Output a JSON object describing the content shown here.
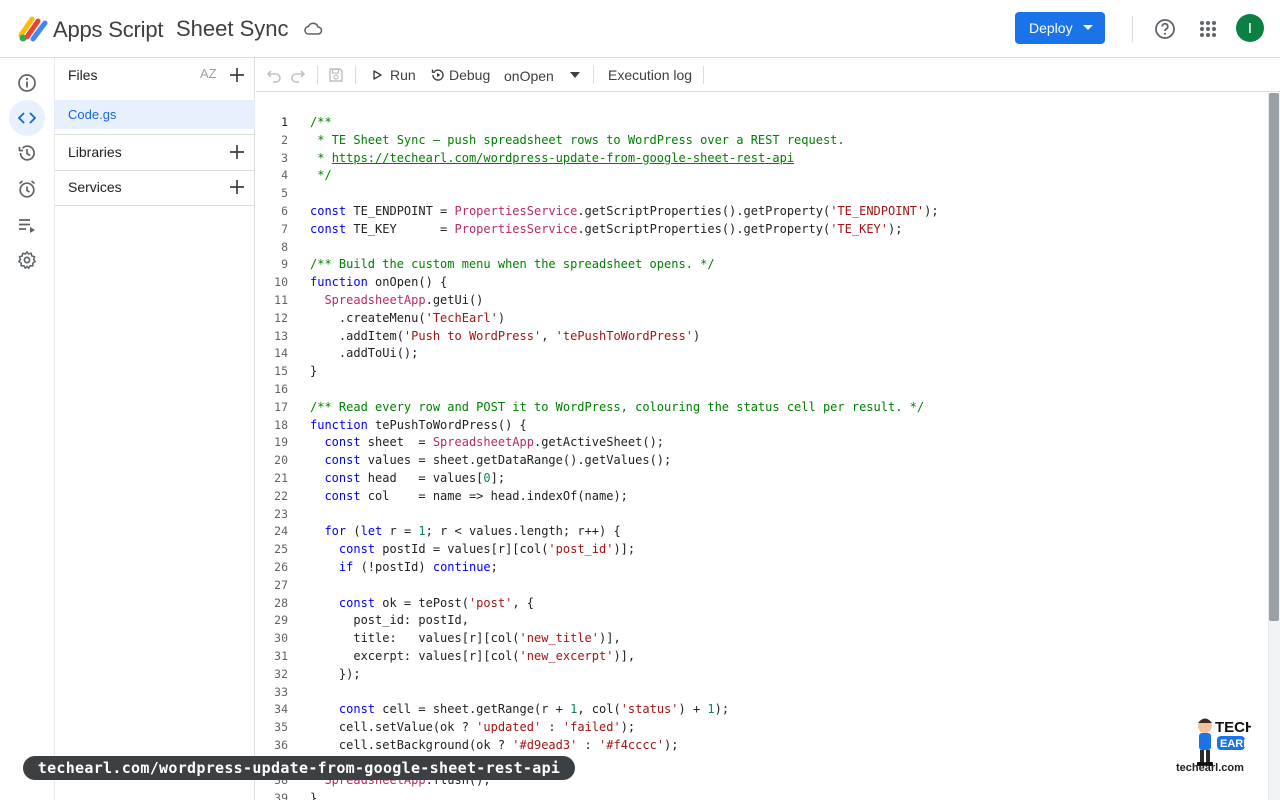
{
  "header": {
    "app_name": "Apps Script",
    "project_name": "Sheet Sync",
    "deploy_label": "Deploy",
    "avatar_letter": "I",
    "icons": [
      "apps-script-logo",
      "cloud-save-icon",
      "help-icon",
      "apps-grid-icon"
    ]
  },
  "rail": {
    "items": [
      "info-icon",
      "code-icon",
      "history-icon",
      "triggers-icon",
      "executions-icon",
      "settings-icon"
    ],
    "active": "code-icon"
  },
  "files_panel": {
    "files_label": "Files",
    "sort_label": "AZ",
    "files": [
      {
        "name": "Code.gs"
      }
    ],
    "libraries_label": "Libraries",
    "services_label": "Services"
  },
  "toolbar": {
    "run_label": "Run",
    "debug_label": "Debug",
    "function_selected": "onOpen",
    "execution_log_label": "Execution log"
  },
  "editor": {
    "current_line": 1,
    "lines": [
      "/**",
      " * TE Sheet Sync — push spreadsheet rows to WordPress over a REST request.",
      " * https://techearl.com/wordpress-update-from-google-sheet-rest-api",
      " */",
      "",
      "const TE_ENDPOINT = PropertiesService.getScriptProperties().getProperty('TE_ENDPOINT');",
      "const TE_KEY      = PropertiesService.getScriptProperties().getProperty('TE_KEY');",
      "",
      "/** Build the custom menu when the spreadsheet opens. */",
      "function onOpen() {",
      "  SpreadsheetApp.getUi()",
      "    .createMenu('TechEarl')",
      "    .addItem('Push to WordPress', 'tePushToWordPress')",
      "    .addToUi();",
      "}",
      "",
      "/** Read every row and POST it to WordPress, colouring the status cell per result. */",
      "function tePushToWordPress() {",
      "  const sheet  = SpreadsheetApp.getActiveSheet();",
      "  const values = sheet.getDataRange().getValues();",
      "  const head   = values[0];",
      "  const col    = name => head.indexOf(name);",
      "",
      "  for (let r = 1; r < values.length; r++) {",
      "    const postId = values[r][col('post_id')];",
      "    if (!postId) continue;",
      "",
      "    const ok = tePost('post', {",
      "      post_id: postId,",
      "      title:   values[r][col('new_title')],",
      "      excerpt: values[r][col('new_excerpt')],",
      "    });",
      "",
      "    const cell = sheet.getRange(r + 1, col('status') + 1);",
      "    cell.setValue(ok ? 'updated' : 'failed');",
      "    cell.setBackground(ok ? '#d9ead3' : '#f4cccc');",
      "  }",
      "  SpreadsheetApp.flush();",
      "}"
    ]
  },
  "overlay": {
    "url_banner": "techearl.com/wordpress-update-from-google-sheet-rest-api",
    "watermark_line1": "TECH",
    "watermark_line2": "EARL",
    "watermark_site": "techearl.com"
  },
  "colors": {
    "accent": "#1a73e8",
    "avatar": "#0b8043",
    "keyword": "#0000ff",
    "comment": "#008000",
    "string": "#a31515",
    "number": "#098658",
    "type": "#b92a6a"
  }
}
